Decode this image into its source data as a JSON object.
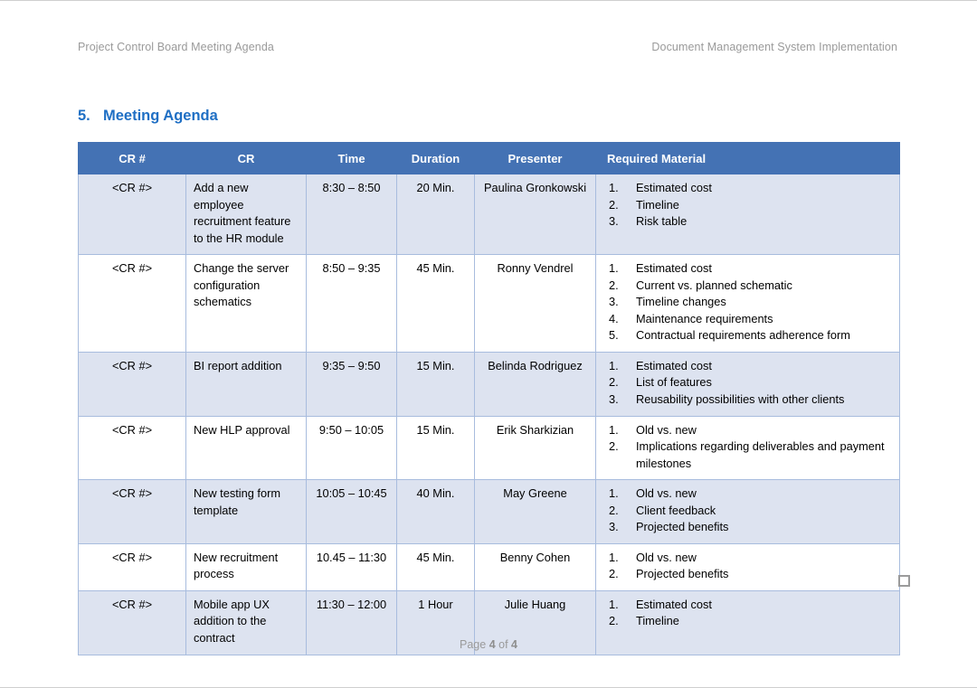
{
  "header": {
    "left": "Project Control Board Meeting Agenda",
    "right": "Document Management System Implementation"
  },
  "section": {
    "number": "5.",
    "title": "Meeting Agenda"
  },
  "table": {
    "columns": [
      "CR #",
      "CR",
      "Time",
      "Duration",
      "Presenter",
      "Required Material"
    ],
    "rows": [
      {
        "cr_num": "<CR #>",
        "cr": "Add a new employee recruitment feature to the HR module",
        "time": "8:30 – 8:50",
        "duration": "20 Min.",
        "presenter": "Paulina Gronkowski",
        "material": [
          "Estimated cost",
          "Timeline",
          "Risk table"
        ]
      },
      {
        "cr_num": "<CR #>",
        "cr": "Change the server configuration schematics",
        "time": "8:50 – 9:35",
        "duration": "45 Min.",
        "presenter": "Ronny Vendrel",
        "material": [
          "Estimated cost",
          "Current vs. planned schematic",
          "Timeline changes",
          "Maintenance requirements",
          "Contractual requirements adherence form"
        ]
      },
      {
        "cr_num": "<CR #>",
        "cr": "BI report addition",
        "time": "9:35 – 9:50",
        "duration": "15 Min.",
        "presenter": "Belinda Rodriguez",
        "material": [
          "Estimated cost",
          "List of features",
          "Reusability possibilities with other clients"
        ]
      },
      {
        "cr_num": "<CR #>",
        "cr": "New HLP approval",
        "time": "9:50 – 10:05",
        "duration": "15 Min.",
        "presenter": "Erik Sharkizian",
        "material": [
          "Old vs. new",
          "Implications regarding deliverables and payment milestones"
        ]
      },
      {
        "cr_num": "<CR #>",
        "cr": "New testing form template",
        "time": "10:05 – 10:45",
        "duration": "40 Min.",
        "presenter": "May Greene",
        "material": [
          "Old vs. new",
          "Client feedback",
          "Projected benefits"
        ]
      },
      {
        "cr_num": "<CR #>",
        "cr": "New recruitment process",
        "time": "10.45 – 11:30",
        "duration": "45 Min.",
        "presenter": "Benny Cohen",
        "material": [
          "Old vs. new",
          "Projected benefits"
        ]
      },
      {
        "cr_num": "<CR #>",
        "cr": "Mobile app UX addition to the contract",
        "time": "11:30 – 12:00",
        "duration": "1 Hour",
        "presenter": "Julie Huang",
        "material": [
          "Estimated cost",
          "Timeline"
        ]
      }
    ]
  },
  "footer": {
    "prefix": "Page ",
    "current_page": "4",
    "middle": " of ",
    "total_pages": "4"
  },
  "colors": {
    "header_fill": "#4472B4",
    "row_shaded": "#DDE3F0",
    "border": "#A8BCDE",
    "heading_text": "#1F6FC4",
    "running_text": "#9A9A9A"
  }
}
